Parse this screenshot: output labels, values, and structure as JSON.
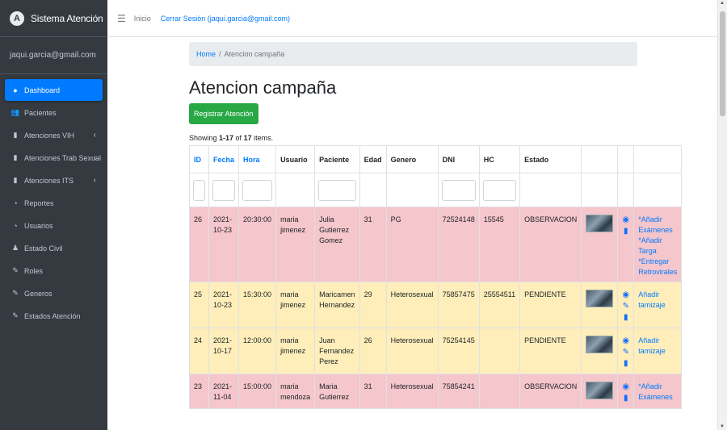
{
  "sidebar": {
    "brand": "Sistema Atención",
    "brand_logo": "A",
    "user": "jaqui.garcia@gmail.com",
    "items": [
      {
        "label": "Dashboard",
        "icon": "dashboard-icon",
        "glyph": "●",
        "active": true,
        "has_caret": false
      },
      {
        "label": "Pacientes",
        "icon": "users-icon",
        "glyph": "👥",
        "active": false,
        "has_caret": false
      },
      {
        "label": "Atenciones VIH",
        "icon": "file-icon",
        "glyph": "▮",
        "active": false,
        "has_caret": true
      },
      {
        "label": "Atenciones Trab Sexual",
        "icon": "file-icon",
        "glyph": "▮",
        "active": false,
        "has_caret": true
      },
      {
        "label": "Atenciones ITS",
        "icon": "file-icon",
        "glyph": "▮",
        "active": false,
        "has_caret": true
      },
      {
        "label": "Reportes",
        "icon": "chart-icon",
        "glyph": "◔",
        "active": false,
        "has_caret": false
      },
      {
        "label": "Usuarios",
        "icon": "chart-icon",
        "glyph": "◔",
        "active": false,
        "has_caret": false
      },
      {
        "label": "Estado Civil",
        "icon": "person-icon",
        "glyph": "♟",
        "active": false,
        "has_caret": false
      },
      {
        "label": "Roles",
        "icon": "edit-icon",
        "glyph": "✎",
        "active": false,
        "has_caret": false
      },
      {
        "label": "Generos",
        "icon": "edit-icon",
        "glyph": "✎",
        "active": false,
        "has_caret": false
      },
      {
        "label": "Estados Atención",
        "icon": "edit-icon",
        "glyph": "✎",
        "active": false,
        "has_caret": false
      }
    ]
  },
  "topbar": {
    "menu_glyph": "☰",
    "home": "Inicio",
    "logout": "Cerrar Sesión (jaqui.garcia@gmail.com)"
  },
  "breadcrumb": {
    "home": "Home",
    "separator": "/",
    "current": "Atencion campaña"
  },
  "page_title": "Atencion campaña",
  "register_button": "Registrar Atención",
  "summary": {
    "prefix": "Showing ",
    "range": "1-17",
    "mid": " of ",
    "total": "17",
    "suffix": " items."
  },
  "table": {
    "columns": [
      {
        "label": "ID",
        "sortable": true,
        "filter": true
      },
      {
        "label": "Fecha",
        "sortable": true,
        "filter": true
      },
      {
        "label": "Hora",
        "sortable": true,
        "filter": true
      },
      {
        "label": "Usuario",
        "sortable": false,
        "filter": false
      },
      {
        "label": "Paciente",
        "sortable": false,
        "filter": true
      },
      {
        "label": "Edad",
        "sortable": false,
        "filter": false
      },
      {
        "label": "Genero",
        "sortable": false,
        "filter": false
      },
      {
        "label": "DNI",
        "sortable": false,
        "filter": true
      },
      {
        "label": "HC",
        "sortable": false,
        "filter": true
      },
      {
        "label": "Estado",
        "sortable": false,
        "filter": false
      },
      {
        "label": "",
        "sortable": false,
        "filter": false
      },
      {
        "label": "",
        "sortable": false,
        "filter": false
      },
      {
        "label": "",
        "sortable": false,
        "filter": false
      }
    ],
    "rows": [
      {
        "tone": "danger",
        "id": "26",
        "fecha": "2021-\n10-23",
        "hora": "20:30:00",
        "usuario": "maria\njimenez",
        "paciente": "Julia\nGutierrez\nGomez",
        "edad": "31",
        "genero": "PG",
        "dni": "72524148",
        "hc": "15545",
        "estado": "OBSERVACION",
        "actions": [
          "eye-icon",
          "trash-icon"
        ],
        "links": [
          "*Añadir Exámenes",
          "*Añadir Targa",
          "*Entregar Retrovirales"
        ]
      },
      {
        "tone": "warning",
        "id": "25",
        "fecha": "2021-\n10-23",
        "hora": "15:30:00",
        "usuario": "maria\njimenez",
        "paciente": "Maricamen\nHernandez",
        "edad": "29",
        "genero": "Heterosexual",
        "dni": "75857475",
        "hc": "25554511",
        "estado": "PENDIENTE",
        "actions": [
          "eye-icon",
          "pencil-icon",
          "trash-icon"
        ],
        "links": [
          "Añadir tamizaje"
        ]
      },
      {
        "tone": "warning",
        "id": "24",
        "fecha": "2021-\n10-17",
        "hora": "12:00:00",
        "usuario": "maria\njimenez",
        "paciente": "Juan\nFernandez\nPerez",
        "edad": "26",
        "genero": "Heterosexual",
        "dni": "75254145",
        "hc": "",
        "estado": "PENDIENTE",
        "actions": [
          "eye-icon",
          "pencil-icon",
          "trash-icon"
        ],
        "links": [
          "Añadir tamizaje"
        ]
      },
      {
        "tone": "danger",
        "id": "23",
        "fecha": "2021-\n11-04",
        "hora": "15:00:00",
        "usuario": "maria\nmendoza",
        "paciente": "Maria\nGutierrez",
        "edad": "31",
        "genero": "Heterosexual",
        "dni": "75854241",
        "hc": "",
        "estado": "OBSERVACION",
        "actions": [
          "eye-icon",
          "trash-icon"
        ],
        "links": [
          "*Añadir Exámenes"
        ]
      }
    ]
  },
  "colors": {
    "sidebar_bg": "#343a40",
    "active_item": "#007bff",
    "register_button": "#28a745",
    "row_danger": "#f5c6cb",
    "row_warning": "#ffeeba",
    "link": "#007bff"
  }
}
